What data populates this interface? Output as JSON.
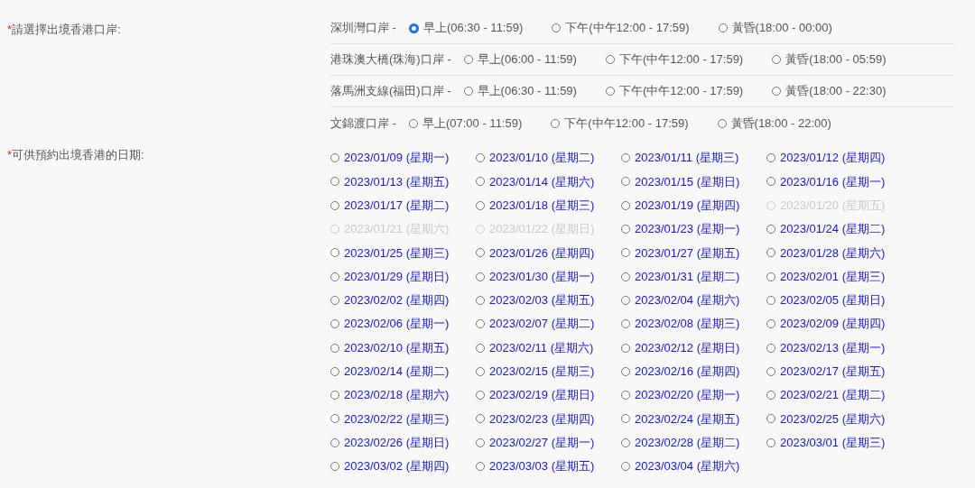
{
  "port_field": {
    "required_mark": "*",
    "label": "請選擇出境香港口岸:",
    "ports": [
      {
        "name": "深圳灣口岸 -",
        "options": [
          {
            "label": "早上(06:30 - 11:59)",
            "selected": true
          },
          {
            "label": "下午(中午12:00 - 17:59)",
            "selected": false
          },
          {
            "label": "黃昏(18:00 - 00:00)",
            "selected": false
          }
        ]
      },
      {
        "name": "港珠澳大橋(珠海)口岸 -",
        "options": [
          {
            "label": "早上(06:00 - 11:59)",
            "selected": false
          },
          {
            "label": "下午(中午12:00 - 17:59)",
            "selected": false
          },
          {
            "label": "黃昏(18:00 - 05:59)",
            "selected": false
          }
        ]
      },
      {
        "name": "落馬洲支線(福田)口岸 -",
        "options": [
          {
            "label": "早上(06:30 - 11:59)",
            "selected": false
          },
          {
            "label": "下午(中午12:00 - 17:59)",
            "selected": false
          },
          {
            "label": "黃昏(18:00 - 22:30)",
            "selected": false
          }
        ]
      },
      {
        "name": "文錦渡口岸 -",
        "options": [
          {
            "label": "早上(07:00 - 11:59)",
            "selected": false
          },
          {
            "label": "下午(中午12:00 - 17:59)",
            "selected": false
          },
          {
            "label": "黃昏(18:00 - 22:00)",
            "selected": false
          }
        ]
      }
    ]
  },
  "date_field": {
    "required_mark": "*",
    "label": "可供預約出境香港的日期:",
    "dates": [
      {
        "label": "2023/01/09 (星期一)",
        "disabled": false,
        "selected": false
      },
      {
        "label": "2023/01/10 (星期二)",
        "disabled": false,
        "selected": false
      },
      {
        "label": "2023/01/11 (星期三)",
        "disabled": false,
        "selected": false
      },
      {
        "label": "2023/01/12 (星期四)",
        "disabled": false,
        "selected": false
      },
      {
        "label": "2023/01/13 (星期五)",
        "disabled": false,
        "selected": false
      },
      {
        "label": "2023/01/14 (星期六)",
        "disabled": false,
        "selected": false
      },
      {
        "label": "2023/01/15 (星期日)",
        "disabled": false,
        "selected": false
      },
      {
        "label": "2023/01/16 (星期一)",
        "disabled": false,
        "selected": false
      },
      {
        "label": "2023/01/17 (星期二)",
        "disabled": false,
        "selected": false
      },
      {
        "label": "2023/01/18 (星期三)",
        "disabled": false,
        "selected": false
      },
      {
        "label": "2023/01/19 (星期四)",
        "disabled": false,
        "selected": false
      },
      {
        "label": "2023/01/20 (星期五)",
        "disabled": true,
        "selected": false
      },
      {
        "label": "2023/01/21 (星期六)",
        "disabled": true,
        "selected": false
      },
      {
        "label": "2023/01/22 (星期日)",
        "disabled": true,
        "selected": false
      },
      {
        "label": "2023/01/23 (星期一)",
        "disabled": false,
        "selected": false
      },
      {
        "label": "2023/01/24 (星期二)",
        "disabled": false,
        "selected": false
      },
      {
        "label": "2023/01/25 (星期三)",
        "disabled": false,
        "selected": false
      },
      {
        "label": "2023/01/26 (星期四)",
        "disabled": false,
        "selected": false
      },
      {
        "label": "2023/01/27 (星期五)",
        "disabled": false,
        "selected": false
      },
      {
        "label": "2023/01/28 (星期六)",
        "disabled": false,
        "selected": false
      },
      {
        "label": "2023/01/29 (星期日)",
        "disabled": false,
        "selected": false
      },
      {
        "label": "2023/01/30 (星期一)",
        "disabled": false,
        "selected": false
      },
      {
        "label": "2023/01/31 (星期二)",
        "disabled": false,
        "selected": false
      },
      {
        "label": "2023/02/01 (星期三)",
        "disabled": false,
        "selected": false
      },
      {
        "label": "2023/02/02 (星期四)",
        "disabled": false,
        "selected": false
      },
      {
        "label": "2023/02/03 (星期五)",
        "disabled": false,
        "selected": false
      },
      {
        "label": "2023/02/04 (星期六)",
        "disabled": false,
        "selected": false
      },
      {
        "label": "2023/02/05 (星期日)",
        "disabled": false,
        "selected": false
      },
      {
        "label": "2023/02/06 (星期一)",
        "disabled": false,
        "selected": false
      },
      {
        "label": "2023/02/07 (星期二)",
        "disabled": false,
        "selected": false
      },
      {
        "label": "2023/02/08 (星期三)",
        "disabled": false,
        "selected": false
      },
      {
        "label": "2023/02/09 (星期四)",
        "disabled": false,
        "selected": false
      },
      {
        "label": "2023/02/10 (星期五)",
        "disabled": false,
        "selected": false
      },
      {
        "label": "2023/02/11 (星期六)",
        "disabled": false,
        "selected": false
      },
      {
        "label": "2023/02/12 (星期日)",
        "disabled": false,
        "selected": false
      },
      {
        "label": "2023/02/13 (星期一)",
        "disabled": false,
        "selected": false
      },
      {
        "label": "2023/02/14 (星期二)",
        "disabled": false,
        "selected": false
      },
      {
        "label": "2023/02/15 (星期三)",
        "disabled": false,
        "selected": false
      },
      {
        "label": "2023/02/16 (星期四)",
        "disabled": false,
        "selected": false
      },
      {
        "label": "2023/02/17 (星期五)",
        "disabled": false,
        "selected": false
      },
      {
        "label": "2023/02/18 (星期六)",
        "disabled": false,
        "selected": false
      },
      {
        "label": "2023/02/19 (星期日)",
        "disabled": false,
        "selected": false
      },
      {
        "label": "2023/02/20 (星期一)",
        "disabled": false,
        "selected": false
      },
      {
        "label": "2023/02/21 (星期二)",
        "disabled": false,
        "selected": false
      },
      {
        "label": "2023/02/22 (星期三)",
        "disabled": false,
        "selected": false
      },
      {
        "label": "2023/02/23 (星期四)",
        "disabled": false,
        "selected": false
      },
      {
        "label": "2023/02/24 (星期五)",
        "disabled": false,
        "selected": false
      },
      {
        "label": "2023/02/25 (星期六)",
        "disabled": false,
        "selected": false
      },
      {
        "label": "2023/02/26 (星期日)",
        "disabled": false,
        "selected": false
      },
      {
        "label": "2023/02/27 (星期一)",
        "disabled": false,
        "selected": false
      },
      {
        "label": "2023/02/28 (星期二)",
        "disabled": false,
        "selected": false
      },
      {
        "label": "2023/03/01 (星期三)",
        "disabled": false,
        "selected": false
      },
      {
        "label": "2023/03/02 (星期四)",
        "disabled": false,
        "selected": false
      },
      {
        "label": "2023/03/03 (星期五)",
        "disabled": false,
        "selected": false
      },
      {
        "label": "2023/03/04 (星期六)",
        "disabled": false,
        "selected": false
      }
    ]
  }
}
